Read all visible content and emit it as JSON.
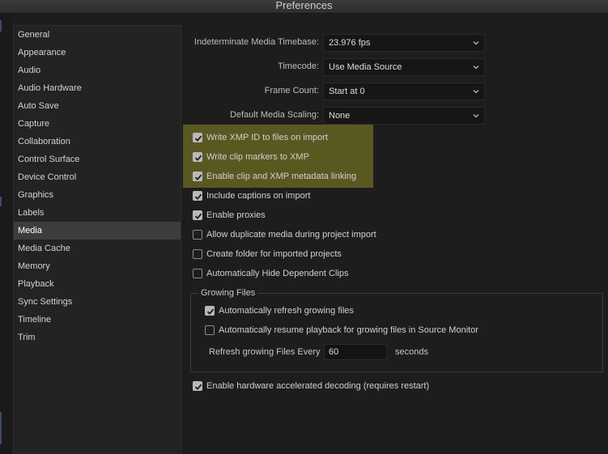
{
  "window": {
    "title": "Preferences"
  },
  "sidebar": {
    "items": [
      {
        "label": "General",
        "selected": false
      },
      {
        "label": "Appearance",
        "selected": false
      },
      {
        "label": "Audio",
        "selected": false
      },
      {
        "label": "Audio Hardware",
        "selected": false
      },
      {
        "label": "Auto Save",
        "selected": false
      },
      {
        "label": "Capture",
        "selected": false
      },
      {
        "label": "Collaboration",
        "selected": false
      },
      {
        "label": "Control Surface",
        "selected": false
      },
      {
        "label": "Device Control",
        "selected": false
      },
      {
        "label": "Graphics",
        "selected": false
      },
      {
        "label": "Labels",
        "selected": false
      },
      {
        "label": "Media",
        "selected": true
      },
      {
        "label": "Media Cache",
        "selected": false
      },
      {
        "label": "Memory",
        "selected": false
      },
      {
        "label": "Playback",
        "selected": false
      },
      {
        "label": "Sync Settings",
        "selected": false
      },
      {
        "label": "Timeline",
        "selected": false
      },
      {
        "label": "Trim",
        "selected": false
      }
    ]
  },
  "media": {
    "timebase": {
      "label": "Indeterminate Media Timebase:",
      "value": "23.976 fps"
    },
    "timecode": {
      "label": "Timecode:",
      "value": "Use Media Source"
    },
    "frame_count": {
      "label": "Frame Count:",
      "value": "Start at 0"
    },
    "scaling": {
      "label": "Default Media Scaling:",
      "value": "None"
    },
    "options": {
      "write_xmp_id": {
        "label": "Write XMP ID to files on import",
        "checked": true
      },
      "write_clip_markers": {
        "label": "Write clip markers to XMP",
        "checked": true
      },
      "enable_linking": {
        "label": "Enable clip and XMP metadata linking",
        "checked": true
      },
      "include_captions": {
        "label": "Include captions on import",
        "checked": true
      },
      "enable_proxies": {
        "label": "Enable proxies",
        "checked": true
      },
      "allow_duplicate": {
        "label": "Allow duplicate media during project import",
        "checked": false
      },
      "create_folder": {
        "label": "Create folder for imported projects",
        "checked": false
      },
      "auto_hide": {
        "label": "Automatically Hide Dependent Clips",
        "checked": false
      },
      "hw_decoding": {
        "label": "Enable hardware accelerated decoding (requires restart)",
        "checked": true
      }
    },
    "growing": {
      "title": "Growing Files",
      "auto_refresh": {
        "label": "Automatically refresh growing files",
        "checked": true
      },
      "auto_resume": {
        "label": "Automatically resume playback for growing files in Source Monitor",
        "checked": false
      },
      "refresh_label": "Refresh growing Files Every",
      "refresh_value": "60",
      "refresh_unit": "seconds"
    },
    "highlight_color": "#807c24"
  },
  "icons": {
    "checkbox_checked": "checkmark-icon",
    "dropdown": "chevron-down-icon"
  }
}
